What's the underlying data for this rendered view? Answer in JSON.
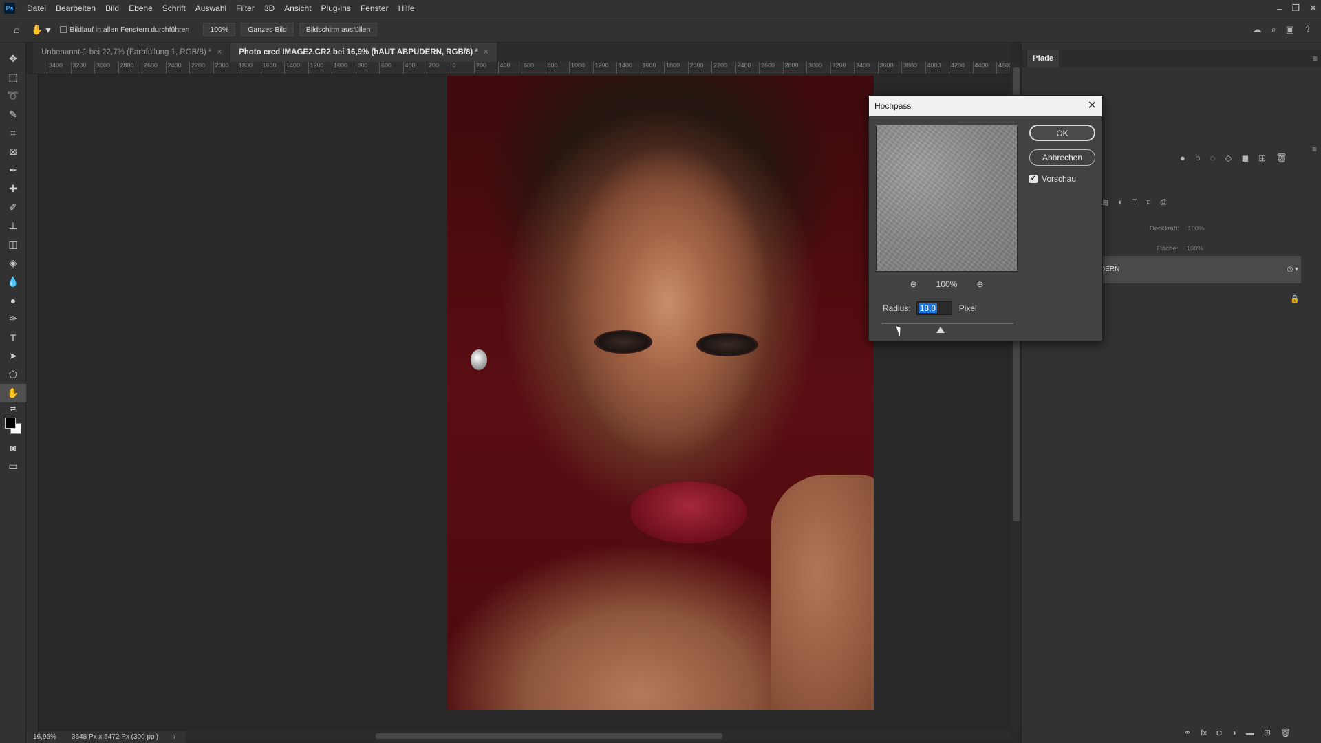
{
  "app": {
    "logo_text": "Ps"
  },
  "menu": [
    "Datei",
    "Bearbeiten",
    "Bild",
    "Ebene",
    "Schrift",
    "Auswahl",
    "Filter",
    "3D",
    "Ansicht",
    "Plug-ins",
    "Fenster",
    "Hilfe"
  ],
  "options_bar": {
    "scroll_all_windows_label": "Bildlauf in allen Fenstern durchführen",
    "scroll_all_windows_checked": false,
    "zoom_btn": "100%",
    "fit_btn": "Ganzes Bild",
    "fill_btn": "Bildschirm ausfüllen"
  },
  "tabs": [
    {
      "label": "Unbenannt-1 bei 22,7% (Farbfüllung 1, RGB/8) *",
      "active": false
    },
    {
      "label": "Photo cred IMAGE2.CR2 bei 16,9% (hAUT ABPUDERN, RGB/8) *",
      "active": true
    }
  ],
  "ruler_ticks": [
    "3400",
    "3200",
    "3000",
    "2800",
    "2600",
    "2400",
    "2200",
    "2000",
    "1800",
    "1600",
    "1400",
    "1200",
    "1000",
    "800",
    "600",
    "400",
    "200",
    "0",
    "200",
    "400",
    "600",
    "800",
    "1000",
    "1200",
    "1400",
    "1600",
    "1800",
    "2000",
    "2200",
    "2400",
    "2600",
    "2800",
    "3000",
    "3200",
    "3400",
    "3600",
    "3800",
    "4000",
    "4200",
    "4400",
    "4600"
  ],
  "status": {
    "zoom": "16,95%",
    "doc_info": "3648 Px x 5472 Px (300 ppi)"
  },
  "right_panel": {
    "tab_label": "Pfade",
    "opacity_label": "Deckkraft:",
    "opacity_value": "100%",
    "fill_label": "Fläche:",
    "fill_value": "100%",
    "layer_name_fragment": "DERN"
  },
  "dialog": {
    "title": "Hochpass",
    "ok_label": "OK",
    "cancel_label": "Abbrechen",
    "preview_label": "Vorschau",
    "preview_checked": true,
    "zoom_level": "100%",
    "radius_label": "Radius:",
    "radius_value": "18,0",
    "radius_unit": "Pixel"
  },
  "colors": {
    "accent": "#1473e6",
    "background": "#282828",
    "panel": "#323232"
  }
}
